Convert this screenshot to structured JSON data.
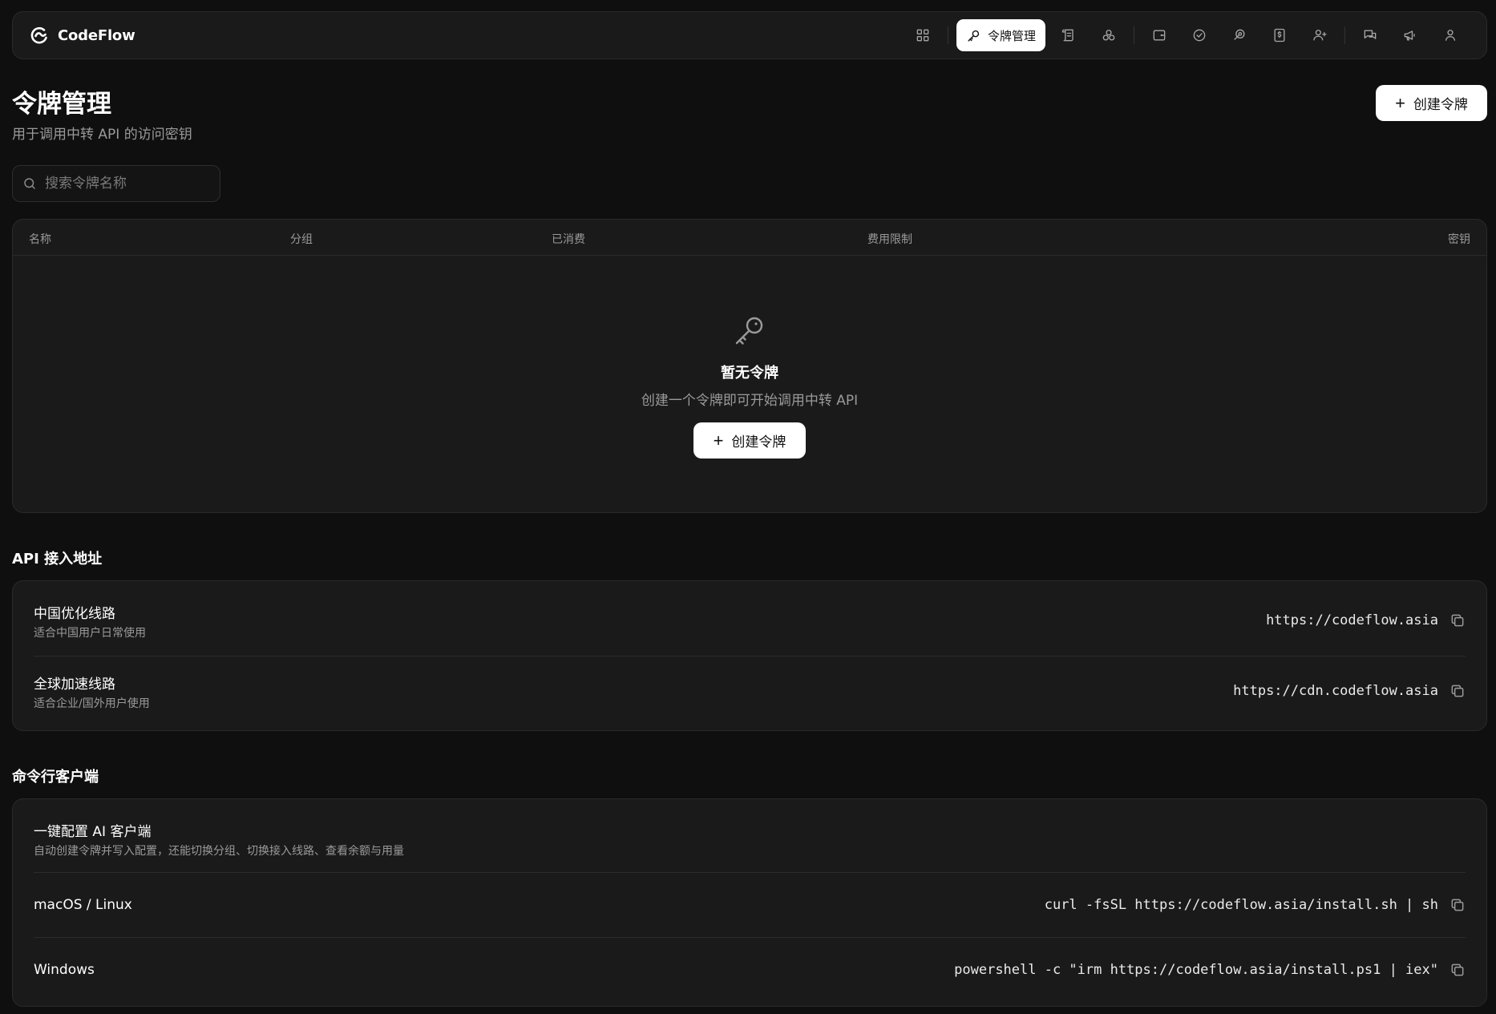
{
  "brand": {
    "name": "CodeFlow"
  },
  "nav": {
    "icons": [
      "dashboard-icon",
      "key-icon",
      "logs-icon",
      "models-icon",
      "wallet-icon",
      "check-circle-icon",
      "link-icon",
      "pricing-icon",
      "user-plus-icon",
      "messages-icon",
      "megaphone-icon",
      "user-icon"
    ],
    "active_label": "令牌管理"
  },
  "header": {
    "title": "令牌管理",
    "subtitle": "用于调用中转 API 的访问密钥",
    "create_label": "创建令牌"
  },
  "search": {
    "placeholder": "搜索令牌名称",
    "value": ""
  },
  "table": {
    "columns": [
      "名称",
      "分组",
      "已消费",
      "费用限制",
      "密钥"
    ],
    "empty_title": "暂无令牌",
    "empty_subtitle": "创建一个令牌即可开始调用中转 API",
    "create_label": "创建令牌"
  },
  "api_section": {
    "title": "API 接入地址",
    "rows": [
      {
        "title": "中国优化线路",
        "subtitle": "适合中国用户日常使用",
        "value": "https://codeflow.asia"
      },
      {
        "title": "全球加速线路",
        "subtitle": "适合企业/国外用户使用",
        "value": "https://cdn.codeflow.asia"
      }
    ]
  },
  "cli_section": {
    "title": "命令行客户端",
    "intro_title": "一键配置 AI 客户端",
    "intro_subtitle": "自动创建令牌并写入配置，还能切换分组、切换接入线路、查看余额与用量",
    "rows": [
      {
        "title": "macOS / Linux",
        "value": "curl -fsSL https://codeflow.asia/install.sh | sh"
      },
      {
        "title": "Windows",
        "value": "powershell -c \"irm https://codeflow.asia/install.ps1 | iex\""
      }
    ]
  },
  "colors": {
    "background": "#0f0f0f",
    "card": "#1a1a1a",
    "border": "#2a2a2a",
    "accent": "#ffffff",
    "muted": "#9a9a9a"
  }
}
